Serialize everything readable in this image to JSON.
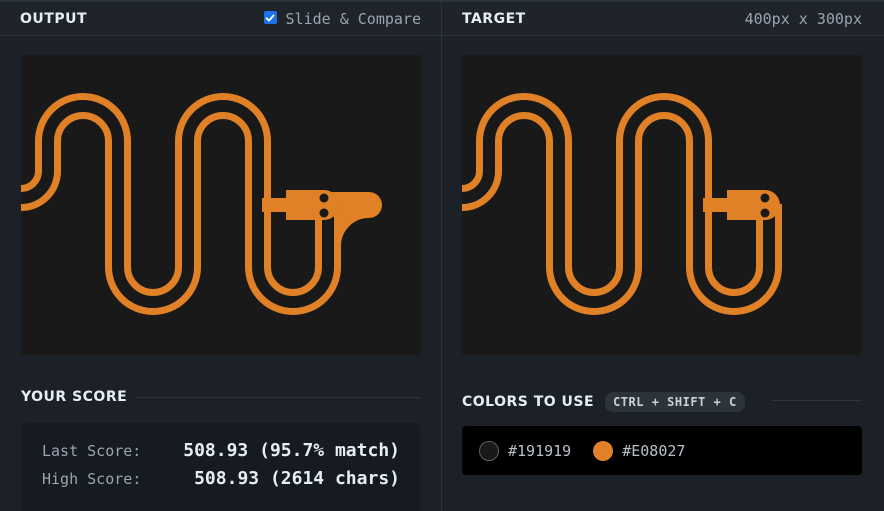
{
  "output_panel": {
    "title": "OUTPUT",
    "slide_compare_label": "Slide & Compare",
    "slide_compare_checked": true
  },
  "target_panel": {
    "title": "TARGET",
    "size_label": "400px x 300px"
  },
  "score": {
    "title": "YOUR SCORE",
    "last_label": "Last Score:",
    "last_value": "508.93 (95.7% match)",
    "high_label": "High Score:",
    "high_value": "508.93 (2614 chars)"
  },
  "colors": {
    "title": "COLORS TO USE",
    "shortcut": "CTRL + SHIFT + C",
    "items": [
      {
        "hex": "#191919",
        "label": "#191919"
      },
      {
        "hex": "#E08027",
        "label": "#E08027"
      }
    ]
  },
  "theme": {
    "canvas_bg": "#191919",
    "snake_color": "#E08027",
    "accent": "#1a73e8"
  }
}
